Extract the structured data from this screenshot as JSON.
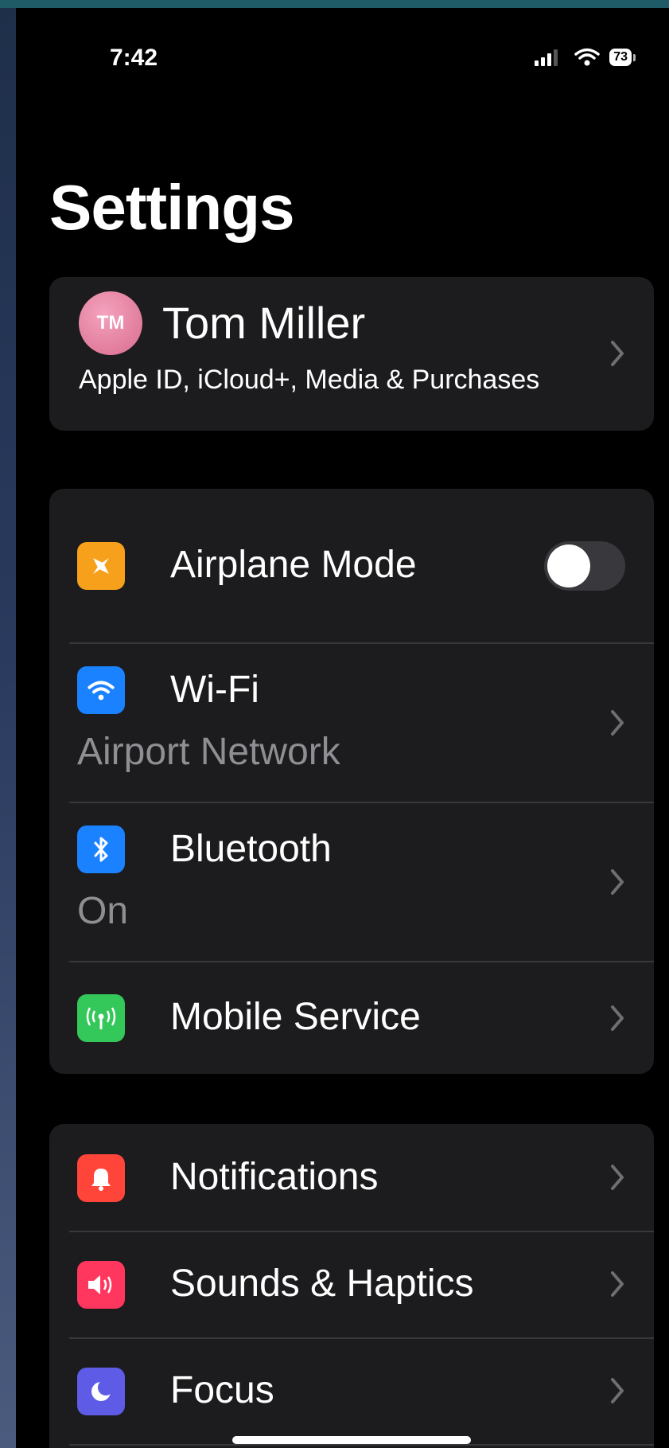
{
  "status": {
    "time": "7:42",
    "battery": "73"
  },
  "title": "Settings",
  "profile": {
    "initials": "TM",
    "name": "Tom Miller",
    "subtitle": "Apple ID, iCloud+, Media & Purchases"
  },
  "connectivity": {
    "airplane": {
      "label": "Airplane Mode",
      "on": false
    },
    "wifi": {
      "label": "Wi-Fi",
      "value": "Airport Network"
    },
    "bluetooth": {
      "label": "Bluetooth",
      "value": "On"
    },
    "mobile": {
      "label": "Mobile Service"
    }
  },
  "general": {
    "notifications": {
      "label": "Notifications"
    },
    "sounds": {
      "label": "Sounds & Haptics"
    },
    "focus": {
      "label": "Focus"
    }
  },
  "colors": {
    "airplane": "#f7a01b",
    "wifi": "#1a82ff",
    "bluetooth": "#1a82ff",
    "mobile": "#34c759",
    "notifications": "#ff453a",
    "sounds": "#ff375f",
    "focus": "#5e5ce6"
  },
  "icons": {
    "airplane": "airplane-icon",
    "wifi": "wifi-icon",
    "bluetooth": "bluetooth-icon",
    "mobile": "antenna-icon",
    "notifications": "bell-icon",
    "sounds": "speaker-icon",
    "focus": "moon-icon"
  }
}
